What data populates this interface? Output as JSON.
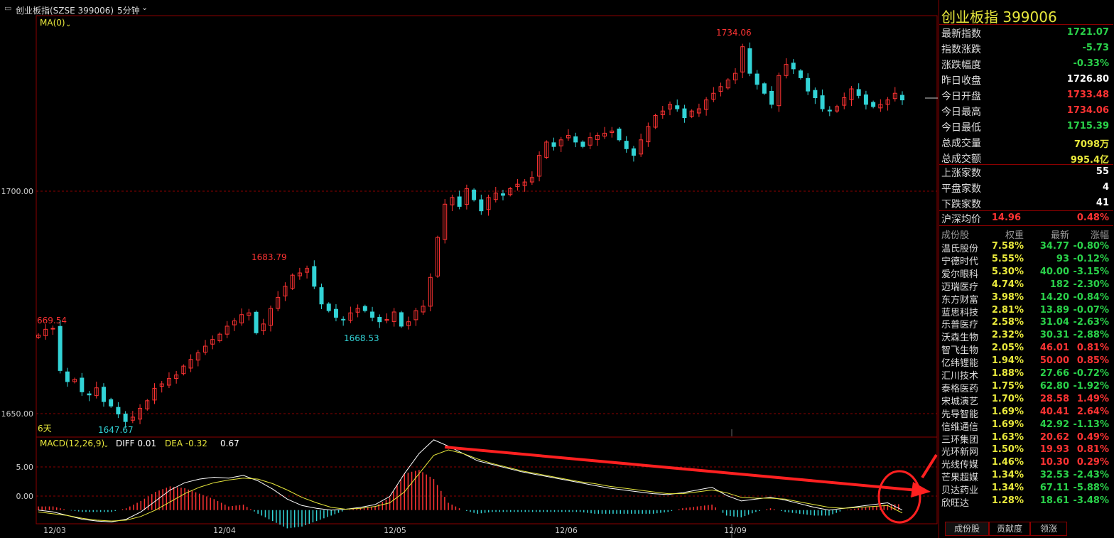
{
  "window": {
    "title": "创业板指(SZSE 399006)",
    "period": "5分钟"
  },
  "indicators": {
    "ma_label": "MA(0)",
    "days_label": "6天",
    "macd_label": "MACD(12,26,9)",
    "diff_label": "DIFF 0.01",
    "dea_label": "DEA -0.32",
    "macd_value": "0.67"
  },
  "colors": {
    "up": "#ff3333",
    "down": "#32d3d6",
    "grid": "#8b0000",
    "diff_line": "#ffffff",
    "dea_line": "#e8e83c",
    "annotation": "#ff2020"
  },
  "chart_data": [
    {
      "type": "candlestick",
      "title": "",
      "ylim": [
        1645,
        1740
      ],
      "y_ticks": [
        "1700.00",
        "1650.00"
      ],
      "x_ticks": [
        "12/03",
        "12/04",
        "12/05",
        "12/06",
        "12/09"
      ],
      "price_labels": [
        {
          "text": "669.54",
          "kind": "high"
        },
        {
          "text": "1647.67",
          "kind": "low"
        },
        {
          "text": "1683.79",
          "kind": "high"
        },
        {
          "text": "1668.53",
          "kind": "low"
        },
        {
          "text": "1734.06",
          "kind": "high"
        }
      ],
      "close_series": [
        1668.0,
        1669.3,
        1669.5,
        1660.0,
        1657.5,
        1658.0,
        1655.2,
        1654.5,
        1656.1,
        1653.0,
        1652.0,
        1650.2,
        1648.5,
        1649.5,
        1651.5,
        1653.2,
        1656.0,
        1657.0,
        1658.2,
        1659.0,
        1661.0,
        1662.5,
        1664.0,
        1665.5,
        1667.0,
        1668.2,
        1670.0,
        1671.2,
        1672.6,
        1673.0,
        1668.5,
        1670.5,
        1674.0,
        1676.5,
        1679.0,
        1681.5,
        1682.0,
        1683.0,
        1679.0,
        1675.0,
        1673.5,
        1672.0,
        1671.5,
        1673.0,
        1674.0,
        1673.5,
        1672.0,
        1671.0,
        1671.5,
        1673.2,
        1670.0,
        1671.0,
        1673.5,
        1674.5,
        1681.0,
        1690.0,
        1697.5,
        1699.0,
        1697.0,
        1701.0,
        1698.5,
        1696.0,
        1699.0,
        1700.0,
        1699.5,
        1701.0,
        1702.0,
        1702.5,
        1703.5,
        1708.5,
        1711.5,
        1710.5,
        1712.0,
        1713.0,
        1711.5,
        1710.5,
        1712.5,
        1713.0,
        1713.5,
        1714.0,
        1712.0,
        1710.0,
        1708.5,
        1712.0,
        1715.0,
        1717.5,
        1718.5,
        1720.0,
        1719.0,
        1717.0,
        1718.5,
        1719.0,
        1721.0,
        1722.5,
        1724.0,
        1725.5,
        1727.0,
        1733.0,
        1727.0,
        1724.5,
        1722.5,
        1720.0,
        1726.5,
        1729.0,
        1728.0,
        1726.0,
        1723.0,
        1721.5,
        1719.0,
        1718.5,
        1719.5,
        1721.5,
        1723.5,
        1722.0,
        1720.0,
        1719.5,
        1720.0,
        1721.0,
        1722.5,
        1721.0
      ]
    },
    {
      "type": "line",
      "title": "",
      "ylim": [
        -1.5,
        8.0
      ],
      "y_ticks": [
        "5.00",
        "0.00"
      ],
      "series": [
        {
          "name": "DIFF",
          "values": [
            0.0,
            -0.2,
            -0.6,
            -1.0,
            -1.2,
            -1.3,
            -1.0,
            -0.2,
            1.0,
            2.2,
            3.0,
            3.4,
            3.6,
            3.5,
            3.8,
            3.2,
            2.3,
            1.2,
            0.5,
            0.2,
            0.0,
            0.1,
            0.3,
            0.6,
            1.5,
            4.0,
            6.2,
            7.7,
            7.0,
            6.2,
            5.4,
            5.0,
            4.6,
            4.2,
            3.9,
            3.6,
            3.3,
            3.0,
            2.7,
            2.4,
            2.2,
            2.0,
            1.8,
            1.7,
            1.9,
            2.2,
            2.5,
            1.6,
            1.0,
            1.2,
            1.4,
            1.1,
            0.7,
            0.3,
            0.0,
            0.2,
            0.4,
            0.6,
            0.8,
            0.01
          ]
        },
        {
          "name": "DEA",
          "values": [
            -0.2,
            -0.4,
            -0.6,
            -0.9,
            -1.1,
            -1.2,
            -1.1,
            -0.7,
            0.0,
            0.9,
            1.8,
            2.5,
            3.0,
            3.3,
            3.5,
            3.4,
            2.9,
            2.2,
            1.4,
            0.8,
            0.3,
            0.1,
            0.2,
            0.4,
            0.8,
            2.0,
            4.0,
            6.0,
            6.6,
            6.2,
            5.6,
            5.1,
            4.7,
            4.3,
            4.0,
            3.7,
            3.4,
            3.1,
            2.9,
            2.6,
            2.4,
            2.2,
            2.0,
            1.8,
            1.8,
            2.0,
            2.2,
            1.9,
            1.4,
            1.3,
            1.3,
            1.2,
            0.9,
            0.6,
            0.3,
            0.2,
            0.3,
            0.4,
            0.5,
            -0.32
          ]
        }
      ]
    }
  ],
  "panel": {
    "title": "创业板指  399006",
    "quote": [
      {
        "label": "最新指数",
        "value": "1721.07",
        "color": "#2ad24a"
      },
      {
        "label": "指数涨跌",
        "value": "-5.73",
        "color": "#2ad24a"
      },
      {
        "label": "涨跌幅度",
        "value": "-0.33%",
        "color": "#2ad24a"
      },
      {
        "label": "昨日收盘",
        "value": "1726.80",
        "color": "#ffffff"
      },
      {
        "label": "今日开盘",
        "value": "1733.48",
        "color": "#ff3333"
      },
      {
        "label": "今日最高",
        "value": "1734.06",
        "color": "#ff3333"
      },
      {
        "label": "今日最低",
        "value": "1715.39",
        "color": "#2ad24a"
      },
      {
        "label": "总成交量",
        "value": "7098万",
        "color": "#e8e83c"
      },
      {
        "label": "总成交额",
        "value": "995.4亿",
        "color": "#e8e83c"
      }
    ],
    "breadth": [
      {
        "label": "上涨家数",
        "value": "55",
        "color": "#ffffff"
      },
      {
        "label": "平盘家数",
        "value": "4",
        "color": "#ffffff"
      },
      {
        "label": "下跌家数",
        "value": "41",
        "color": "#ffffff"
      }
    ],
    "avg": {
      "label": "沪深均价",
      "price": "14.96",
      "change": "0.48%"
    },
    "constituents_header": {
      "name": "成份股",
      "weight": "权重",
      "price": "最新",
      "change": "涨幅"
    },
    "constituents": [
      {
        "name": "温氏股份",
        "weight": "7.58%",
        "price": "34.77",
        "change": "-0.80%",
        "up": false
      },
      {
        "name": "宁德时代",
        "weight": "5.55%",
        "price": "93",
        "change": "-0.12%",
        "up": false
      },
      {
        "name": "爱尔眼科",
        "weight": "5.30%",
        "price": "40.00",
        "change": "-3.15%",
        "up": false
      },
      {
        "name": "迈瑞医疗",
        "weight": "4.74%",
        "price": "182",
        "change": "-2.30%",
        "up": false
      },
      {
        "name": "东方财富",
        "weight": "3.98%",
        "price": "14.20",
        "change": "-0.84%",
        "up": false
      },
      {
        "name": "蓝思科技",
        "weight": "2.81%",
        "price": "13.89",
        "change": "-0.07%",
        "up": false
      },
      {
        "name": "乐普医疗",
        "weight": "2.58%",
        "price": "31.04",
        "change": "-2.63%",
        "up": false
      },
      {
        "name": "沃森生物",
        "weight": "2.32%",
        "price": "30.31",
        "change": "-2.88%",
        "up": false
      },
      {
        "name": "智飞生物",
        "weight": "2.05%",
        "price": "46.01",
        "change": "0.81%",
        "up": true
      },
      {
        "name": "亿纬锂能",
        "weight": "1.94%",
        "price": "50.00",
        "change": "0.85%",
        "up": true
      },
      {
        "name": "汇川技术",
        "weight": "1.88%",
        "price": "27.66",
        "change": "-0.72%",
        "up": false
      },
      {
        "name": "泰格医药",
        "weight": "1.75%",
        "price": "62.80",
        "change": "-1.92%",
        "up": false
      },
      {
        "name": "宋城演艺",
        "weight": "1.70%",
        "price": "28.58",
        "change": "1.49%",
        "up": true
      },
      {
        "name": "先导智能",
        "weight": "1.69%",
        "price": "40.41",
        "change": "2.64%",
        "up": true
      },
      {
        "name": "信维通信",
        "weight": "1.69%",
        "price": "42.92",
        "change": "-1.13%",
        "up": false
      },
      {
        "name": "三环集团",
        "weight": "1.63%",
        "price": "20.62",
        "change": "0.49%",
        "up": true
      },
      {
        "name": "光环新网",
        "weight": "1.50%",
        "price": "19.93",
        "change": "0.81%",
        "up": true
      },
      {
        "name": "光线传媒",
        "weight": "1.46%",
        "price": "10.30",
        "change": "0.29%",
        "up": true
      },
      {
        "name": "芒果超媒",
        "weight": "1.34%",
        "price": "32.53",
        "change": "-2.43%",
        "up": false
      },
      {
        "name": "贝达药业",
        "weight": "1.34%",
        "price": "67.11",
        "change": "-5.88%",
        "up": false
      },
      {
        "name": "欣旺达",
        "weight": "1.28%",
        "price": "18.61",
        "change": "-3.48%",
        "up": false
      }
    ],
    "tabs": [
      "成份股",
      "贡献度",
      "领涨"
    ]
  }
}
